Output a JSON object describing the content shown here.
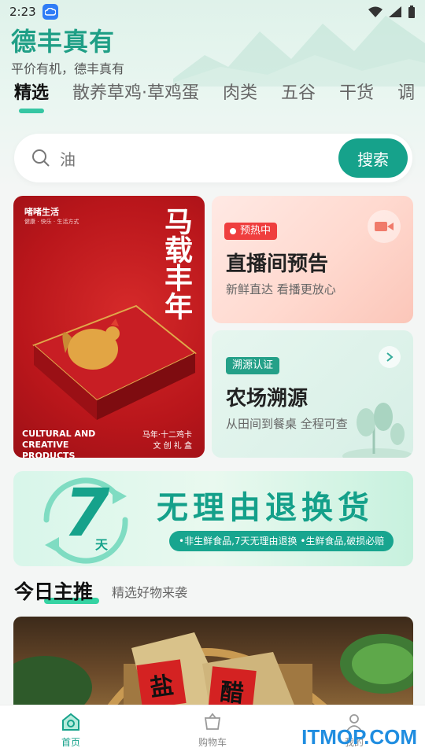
{
  "status_bar": {
    "time": "2:23"
  },
  "header": {
    "title": "德丰真有",
    "subtitle": "平价有机，德丰真有"
  },
  "tabs": [
    {
      "label": "精选",
      "active": true
    },
    {
      "label": "散养草鸡·草鸡蛋",
      "active": false
    },
    {
      "label": "肉类",
      "active": false
    },
    {
      "label": "五谷",
      "active": false
    },
    {
      "label": "干货",
      "active": false
    },
    {
      "label": "调",
      "active": false
    }
  ],
  "search": {
    "value": "油",
    "button_label": "搜索"
  },
  "promo_left": {
    "brand": "啫啫生活",
    "brand_sub": "健康 · 快乐 · 生活方式",
    "calligraphy": "马载丰年",
    "en_text": "CULTURAL AND CREATIVE PRODUCTS",
    "cn_title": "马年·十二鸡卡",
    "cn_sub": "文 创 礼 盒"
  },
  "live_card": {
    "badge": "预热中",
    "title": "直播间预告",
    "subtitle": "新鲜直达 看播更放心"
  },
  "farm_card": {
    "badge": "溯源认证",
    "title": "农场溯源",
    "subtitle": "从田间到餐桌 全程可查"
  },
  "return_banner": {
    "big_number": "7",
    "unit": "天",
    "title": "无理由退换货",
    "note": "•非生鲜食品,7天无理由退换 •生鲜食品,破损必赔"
  },
  "today_section": {
    "title": "今日主推",
    "subtitle": "精选好物来袭",
    "product_labels": [
      "盐",
      "醋"
    ]
  },
  "bottom_nav": [
    {
      "label": "首页",
      "icon": "home-icon",
      "active": true
    },
    {
      "label": "购物车",
      "icon": "cart-icon",
      "active": false
    },
    {
      "label": "我的",
      "icon": "user-icon",
      "active": false
    }
  ],
  "watermark": "ITMOP.COM",
  "colors": {
    "brand_green": "#16a28b",
    "live_red": "#ef3e3e",
    "watermark_blue": "#1f8de0"
  }
}
